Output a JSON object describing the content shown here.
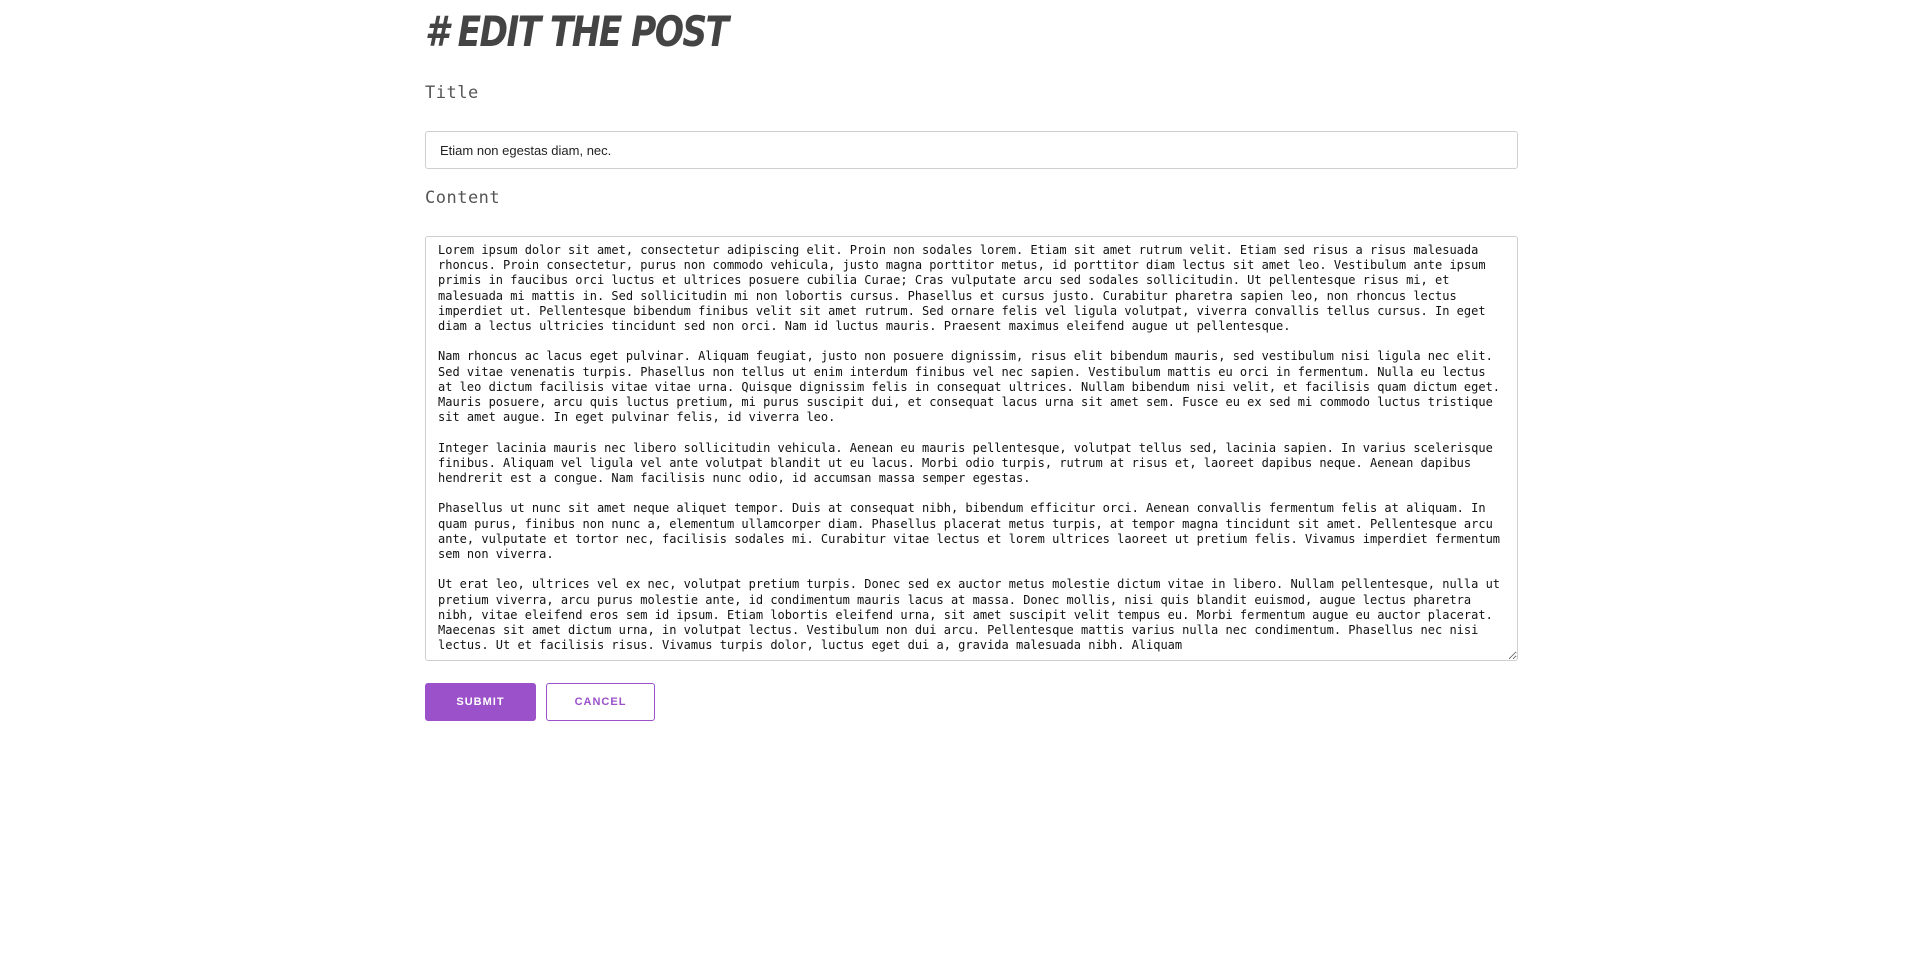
{
  "heading": "# EDIT THE POST",
  "form": {
    "title_label": "Title",
    "title_value": "Etiam non egestas diam, nec.",
    "content_label": "Content",
    "content_value": "Lorem ipsum dolor sit amet, consectetur adipiscing elit. Proin non sodales lorem. Etiam sit amet rutrum velit. Etiam sed risus a risus malesuada rhoncus. Proin consectetur, purus non commodo vehicula, justo magna porttitor metus, id porttitor diam lectus sit amet leo. Vestibulum ante ipsum primis in faucibus orci luctus et ultrices posuere cubilia Curae; Cras vulputate arcu sed sodales sollicitudin. Ut pellentesque risus mi, et malesuada mi mattis in. Sed sollicitudin mi non lobortis cursus. Phasellus et cursus justo. Curabitur pharetra sapien leo, non rhoncus lectus imperdiet ut. Pellentesque bibendum finibus velit sit amet rutrum. Sed ornare felis vel ligula volutpat, viverra convallis tellus cursus. In eget diam a lectus ultricies tincidunt sed non orci. Nam id luctus mauris. Praesent maximus eleifend augue ut pellentesque.\n\nNam rhoncus ac lacus eget pulvinar. Aliquam feugiat, justo non posuere dignissim, risus elit bibendum mauris, sed vestibulum nisi ligula nec elit. Sed vitae venenatis turpis. Phasellus non tellus ut enim interdum finibus vel nec sapien. Vestibulum mattis eu orci in fermentum. Nulla eu lectus at leo dictum facilisis vitae vitae urna. Quisque dignissim felis in consequat ultrices. Nullam bibendum nisi velit, et facilisis quam dictum eget. Mauris posuere, arcu quis luctus pretium, mi purus suscipit dui, et consequat lacus urna sit amet sem. Fusce eu ex sed mi commodo luctus tristique sit amet augue. In eget pulvinar felis, id viverra leo.\n\nInteger lacinia mauris nec libero sollicitudin vehicula. Aenean eu mauris pellentesque, volutpat tellus sed, lacinia sapien. In varius scelerisque finibus. Aliquam vel ligula vel ante volutpat blandit ut eu lacus. Morbi odio turpis, rutrum at risus et, laoreet dapibus neque. Aenean dapibus hendrerit est a congue. Nam facilisis nunc odio, id accumsan massa semper egestas.\n\nPhasellus ut nunc sit amet neque aliquet tempor. Duis at consequat nibh, bibendum efficitur orci. Aenean convallis fermentum felis at aliquam. In quam purus, finibus non nunc a, elementum ullamcorper diam. Phasellus placerat metus turpis, at tempor magna tincidunt sit amet. Pellentesque arcu ante, vulputate et tortor nec, facilisis sodales mi. Curabitur vitae lectus et lorem ultrices laoreet ut pretium felis. Vivamus imperdiet fermentum sem non viverra.\n\nUt erat leo, ultrices vel ex nec, volutpat pretium turpis. Donec sed ex auctor metus molestie dictum vitae in libero. Nullam pellentesque, nulla ut pretium viverra, arcu purus molestie ante, id condimentum mauris lacus at massa. Donec mollis, nisi quis blandit euismod, augue lectus pharetra nibh, vitae eleifend eros sem id ipsum. Etiam lobortis eleifend urna, sit amet suscipit velit tempus eu. Morbi fermentum augue eu auctor placerat. Maecenas sit amet dictum urna, in volutpat lectus. Vestibulum non dui arcu. Pellentesque mattis varius nulla nec condimentum. Phasellus nec nisi lectus. Ut et facilisis risus. Vivamus turpis dolor, luctus eget dui a, gravida malesuada nibh. Aliquam"
  },
  "actions": {
    "submit_label": "SUBMIT",
    "cancel_label": "CANCEL"
  },
  "colors": {
    "accent": "#9b51c9",
    "heading": "#444444"
  }
}
